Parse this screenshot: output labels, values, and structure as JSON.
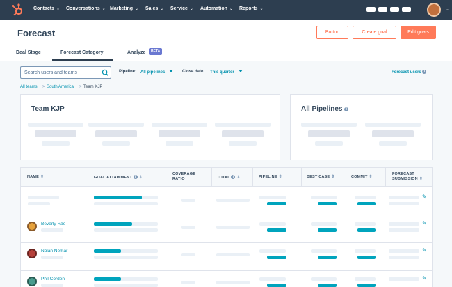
{
  "nav": {
    "items": [
      {
        "label": "Contacts"
      },
      {
        "label": "Conversations"
      },
      {
        "label": "Marketing"
      },
      {
        "label": "Sales"
      },
      {
        "label": "Service"
      },
      {
        "label": "Automation"
      },
      {
        "label": "Reports"
      }
    ],
    "chevron": "⌄",
    "logo_icon": "hubspot-sprocket-icon",
    "colors": {
      "bar": "#2d3e50"
    }
  },
  "header": {
    "title": "Forecast",
    "buttons": {
      "button": "Button",
      "create_goal": "Create goal",
      "edit_goals": "Edit goals"
    },
    "tabs": [
      {
        "label": "Deal Stage",
        "active": false
      },
      {
        "label": "Forecast Category",
        "active": true
      },
      {
        "label": "Analyze",
        "active": false
      }
    ],
    "beta_badge": "BETA"
  },
  "filters": {
    "search_placeholder": "Search users and teams",
    "pipeline_label": "Pipeline:",
    "pipeline_value": "All pipelines",
    "close_date_label": "Close date:",
    "close_date_value": "This quarter",
    "forecast_users": "Forecast users"
  },
  "breadcrumb": {
    "items": [
      "All teams",
      "South America",
      "Team KJP"
    ],
    "separator": ">"
  },
  "cards": {
    "team_title": "Team KJP",
    "pipelines_title": "All Pipelines"
  },
  "table": {
    "headers": {
      "name": "NAME",
      "goal_attainment": "GOAL ATTAINMENT",
      "coverage_ratio_1": "COVERAGE",
      "coverage_ratio_2": "RATIO",
      "total": "TOTAL",
      "pipeline": "PIPELINE",
      "best_case": "BEST CASE",
      "commit": "COMMIT",
      "forecast_submission_1": "FORECAST",
      "forecast_submission_2": "SUBMISSION"
    },
    "rows": [
      {
        "name": "",
        "goal_attainment": 0.75
      },
      {
        "name": "Beverly Rae",
        "goal_attainment": 0.6
      },
      {
        "name": "Nolan Nemar",
        "goal_attainment": 0.42
      },
      {
        "name": "Phil Corden",
        "goal_attainment": 0.42
      }
    ],
    "colors": {
      "accent": "#00a4bd",
      "link": "#0091ae",
      "cta": "#ff7a59"
    }
  }
}
